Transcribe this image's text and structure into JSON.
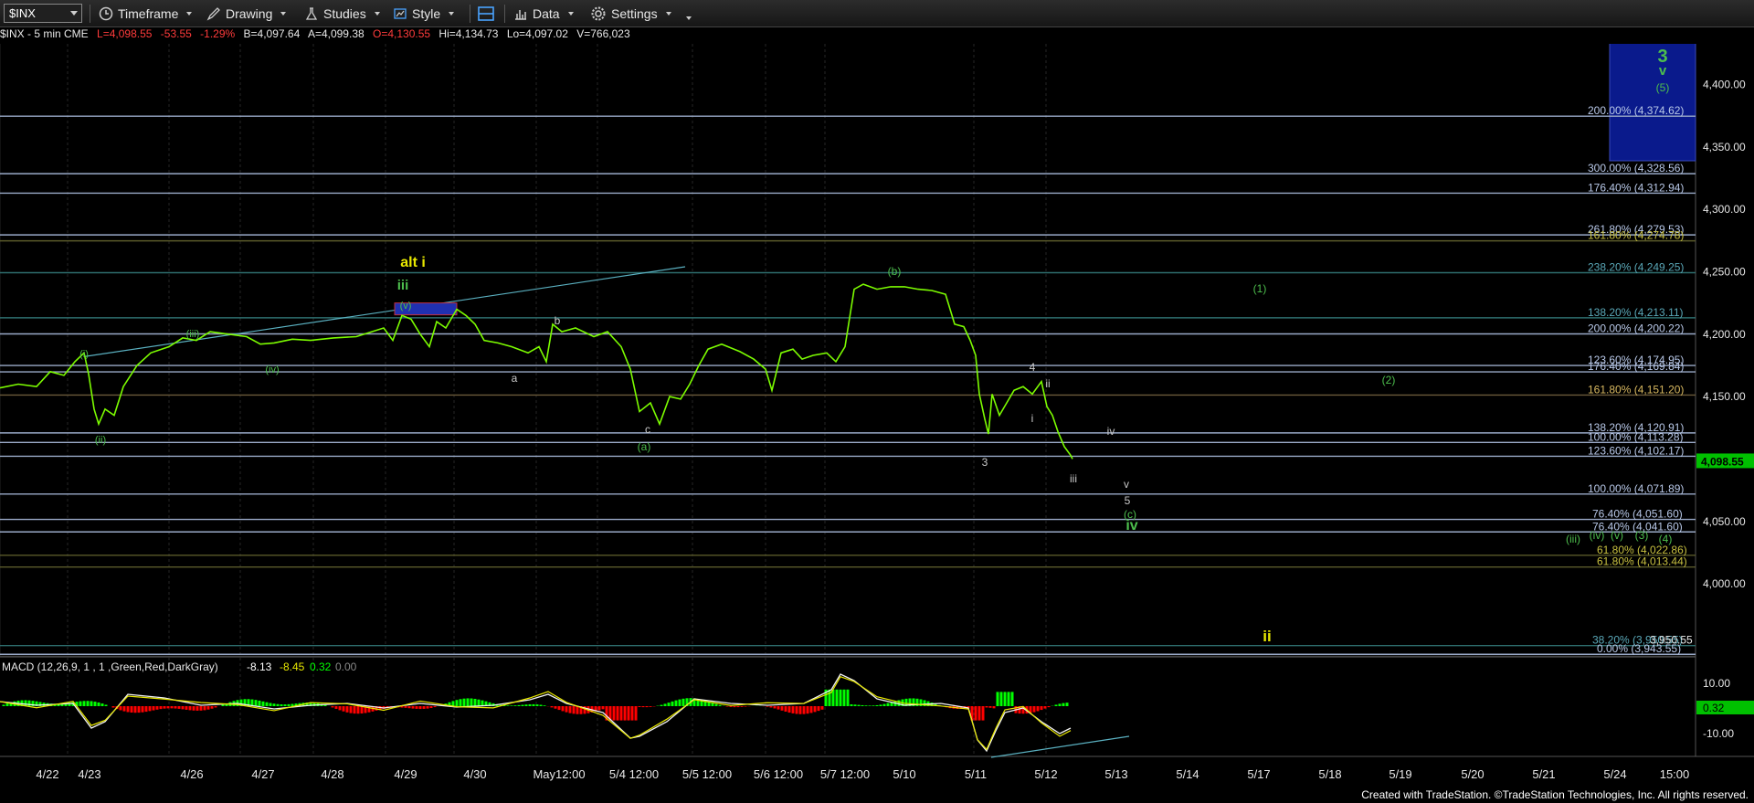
{
  "toolbar": {
    "symbol": "$INX",
    "buttons": [
      "Timeframe",
      "Drawing",
      "Studies",
      "Style",
      "",
      "Data",
      "Settings",
      ""
    ]
  },
  "header": {
    "symbol": "$INX - 5 min  CME",
    "last": "L=4,098.55",
    "chg": "-53.55",
    "pct": "-1.29%",
    "bid": "B=4,097.64",
    "ask": "A=4,099.38",
    "open": "O=4,130.55",
    "hi": "Hi=4,134.73",
    "lo": "Lo=4,097.02",
    "vol": "V=766,023"
  },
  "colors": {
    "price": "#7CFC00",
    "grid": "#2a2a2a",
    "fib_lines": "#b8c8e8",
    "fib_teal": "#2e6e6e",
    "fib_orange": "#6b5a3a",
    "label_gray": "#c8c8c8",
    "label_green": "#4dbf4d",
    "label_yellow": "#e8e800",
    "target_box": "#0a1a8c",
    "macd_line": "#f2f2f2",
    "signal_line": "#e8e800",
    "hist_pos": "#00ff00",
    "hist_neg": "#ff0000",
    "last_badge": "#00c000"
  },
  "chart_data": {
    "type": "line",
    "title": "$INX - 5 min",
    "ylim": [
      3935,
      4440
    ],
    "y_ticks": [
      "4,400.00",
      "4,350.00",
      "4,300.00",
      "4,250.00",
      "4,200.00",
      "4,150.00",
      "4,100.00",
      "4,050.00",
      "4,000.00"
    ],
    "x_ticks": [
      "4/22",
      "4/23",
      "4/26",
      "4/27",
      "4/28",
      "4/29",
      "4/30",
      "May12:00",
      "5/4 12:00",
      "5/5 12:00",
      "5/6 12:00",
      "5/7 12:00",
      "5/10",
      "5/11",
      "5/12",
      "5/13",
      "5/14",
      "5/17",
      "5/18",
      "5/19",
      "5/20",
      "5/21",
      "5/24",
      "15:00"
    ],
    "last_price": "4,098.55",
    "fib_levels": [
      {
        "label": "200.00% (4,374.62)",
        "value": 4374.62
      },
      {
        "label": "300.00% (4,328.56)",
        "value": 4328.56
      },
      {
        "label": "176.40% (4,312.94)",
        "value": 4312.94
      },
      {
        "label": "261.80% (4,279.53)",
        "value": 4279.53
      },
      {
        "label": "161.80% (4,274.78)",
        "value": 4274.78
      },
      {
        "label": "238.20% (4,249.25)",
        "value": 4249.25
      },
      {
        "label": "138.20% (4,213.11)",
        "value": 4213.11
      },
      {
        "label": "200.00% (4,200.22)",
        "value": 4200.22
      },
      {
        "label": "123.60% (4,174.95)",
        "value": 4174.95
      },
      {
        "label": "176.40% (4,169.84)",
        "value": 4169.84
      },
      {
        "label": "161.80% (4,151.20)",
        "value": 4151.2
      },
      {
        "label": "138.20% (4,120.91)",
        "value": 4120.91
      },
      {
        "label": "100.00% (4,113.28)",
        "value": 4113.28
      },
      {
        "label": "123.60% (4,102.17)",
        "value": 4102.17
      },
      {
        "label": "100.00% (4,071.89)",
        "value": 4071.89
      },
      {
        "label": "76.40% (4,051.60)",
        "value": 4051.6
      },
      {
        "label": "76.40% (4,041.60)",
        "value": 4041.6
      },
      {
        "label": "61.80% (4,022.86)",
        "value": 4022.86
      },
      {
        "label": "61.80% (4,013.44)",
        "value": 4013.44
      },
      {
        "label": "38.20% (3,950.55)",
        "value": 3950.55
      },
      {
        "label": "0.00% (3,943.55)",
        "value": 3943.55
      }
    ],
    "right_box_label": "3,950.55",
    "wave_labels": [
      {
        "text": "alt i",
        "color": "yellow",
        "bold": true
      },
      {
        "text": "iii",
        "color": "green",
        "bold": true
      },
      {
        "text": "(v)",
        "color": "green"
      },
      {
        "text": "(i)",
        "color": "green"
      },
      {
        "text": "(ii)",
        "color": "green"
      },
      {
        "text": "(iii)",
        "color": "green"
      },
      {
        "text": "(iv)",
        "color": "green"
      },
      {
        "text": "a",
        "color": "gray"
      },
      {
        "text": "b",
        "color": "gray"
      },
      {
        "text": "c",
        "color": "gray"
      },
      {
        "text": "(a)",
        "color": "green"
      },
      {
        "text": "(b)",
        "color": "green"
      },
      {
        "text": "(c)",
        "color": "green"
      },
      {
        "text": "3",
        "color": "gray"
      },
      {
        "text": "4",
        "color": "gray"
      },
      {
        "text": "5",
        "color": "gray"
      },
      {
        "text": "i",
        "color": "gray"
      },
      {
        "text": "ii",
        "color": "gray"
      },
      {
        "text": "iii",
        "color": "gray"
      },
      {
        "text": "iv",
        "color": "gray"
      },
      {
        "text": "v",
        "color": "gray"
      },
      {
        "text": "iv",
        "color": "green",
        "bold": true
      },
      {
        "text": "(1)",
        "color": "green"
      },
      {
        "text": "(2)",
        "color": "green"
      },
      {
        "text": "(iii)",
        "color": "green"
      },
      {
        "text": "(iv)",
        "color": "green"
      },
      {
        "text": "(v)",
        "color": "green"
      },
      {
        "text": "(3)",
        "color": "green"
      },
      {
        "text": "(4)",
        "color": "green"
      },
      {
        "text": "ii",
        "color": "yellow",
        "bold": true
      },
      {
        "text": "3",
        "color": "green",
        "bold": true
      },
      {
        "text": "v",
        "color": "green",
        "bold": true
      },
      {
        "text": "(5)",
        "color": "green"
      }
    ],
    "macd": {
      "label": "MACD (12,26,9, 1 , 1 ,Green,Red,DarkGray)",
      "macd": "-8.13",
      "signal": "-8.45",
      "hist": "0.32",
      "zero": "0.00",
      "ticks": [
        "10.00",
        "-10.00"
      ],
      "last": "0.32"
    }
  },
  "footer": "Created with TradeStation. ©TradeStation Technologies, Inc. All rights reserved."
}
